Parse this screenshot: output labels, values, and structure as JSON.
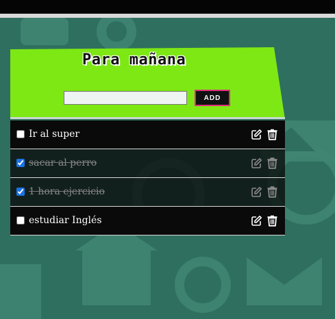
{
  "header": {
    "title": "Para mañana"
  },
  "form": {
    "input_value": "",
    "input_placeholder": "",
    "add_label": "ADD"
  },
  "tasks": [
    {
      "text": "Ir al super",
      "done": false
    },
    {
      "text": "sacar al perro",
      "done": true
    },
    {
      "text": "1 hora ejercicio",
      "done": true
    },
    {
      "text": "estudiar Inglés",
      "done": false
    }
  ],
  "colors": {
    "header_bg": "#7de814",
    "page_bg": "#2f6f5f",
    "row_bg": "#0a0a0a",
    "add_border": "#e0307a"
  },
  "icons": [
    "edit-icon",
    "trash-icon"
  ]
}
